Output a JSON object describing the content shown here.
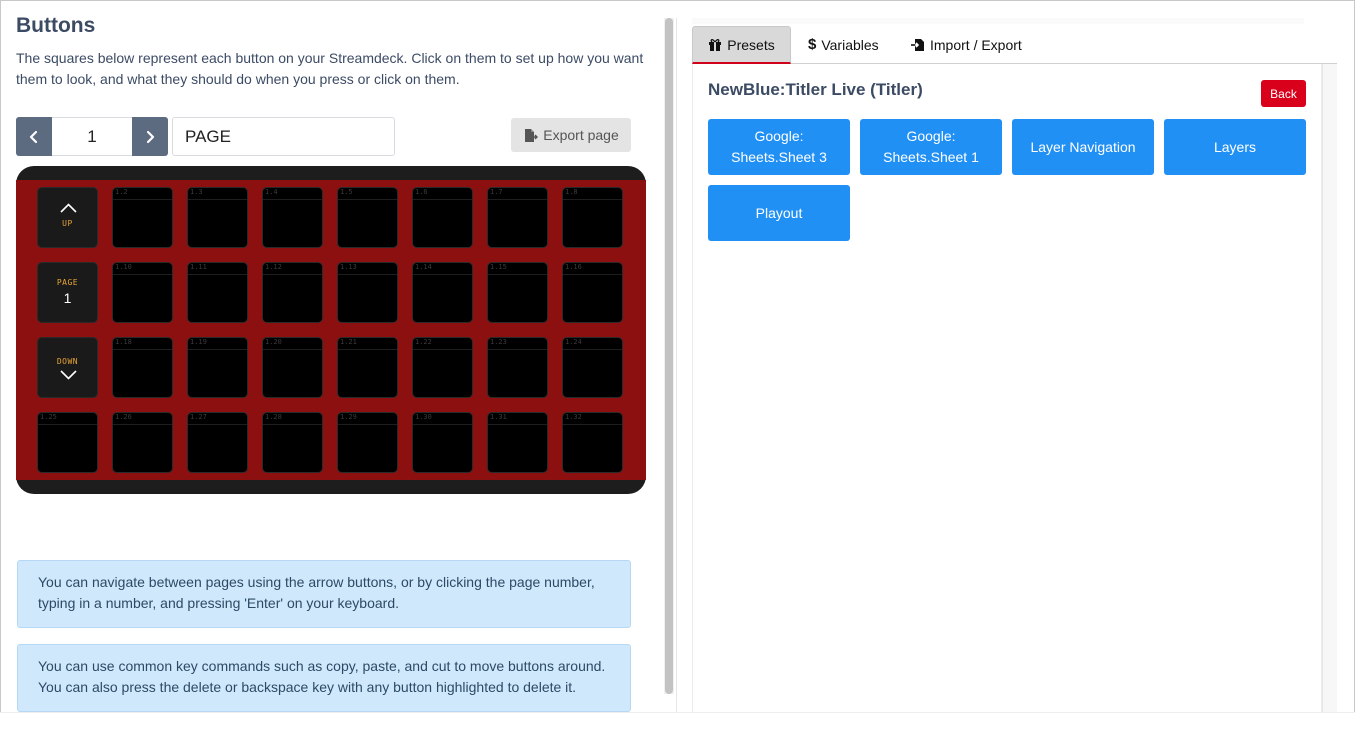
{
  "left": {
    "title": "Buttons",
    "intro": "The squares below represent each button on your Streamdeck. Click on them to set up how you want them to look, and what they should do when you press or click on them.",
    "pager": {
      "page_number": "1",
      "page_name": "PAGE",
      "export_label": "Export page"
    },
    "nav_keys": {
      "up": "UP",
      "page_label": "PAGE",
      "page_value": "1",
      "down": "DOWN"
    },
    "hints": [
      "You can navigate between pages using the arrow buttons, or by clicking the page number, typing in a number, and pressing 'Enter' on your keyboard.",
      "You can use common key commands such as copy, paste, and cut to move buttons around. You can also press the delete or backspace key with any button highlighted to delete it."
    ]
  },
  "right": {
    "tabs": [
      {
        "label": "Presets",
        "icon": "gift-icon",
        "active": true
      },
      {
        "label": "Variables",
        "icon": "dollar-icon",
        "active": false
      },
      {
        "label": "Import / Export",
        "icon": "file-import-icon",
        "active": false
      }
    ],
    "connection_title": "NewBlue:Titler Live (Titler)",
    "back_label": "Back",
    "presets": [
      "Google: Sheets.Sheet 3",
      "Google: Sheets.Sheet 1",
      "Layer Navigation",
      "Layers",
      "Playout"
    ]
  },
  "colors": {
    "deck_red": "#8c1010",
    "preset_blue": "#2190f5",
    "back_red": "#d9001b",
    "hint_bg": "#d0e8fb",
    "nav_text": "#e6a434"
  }
}
